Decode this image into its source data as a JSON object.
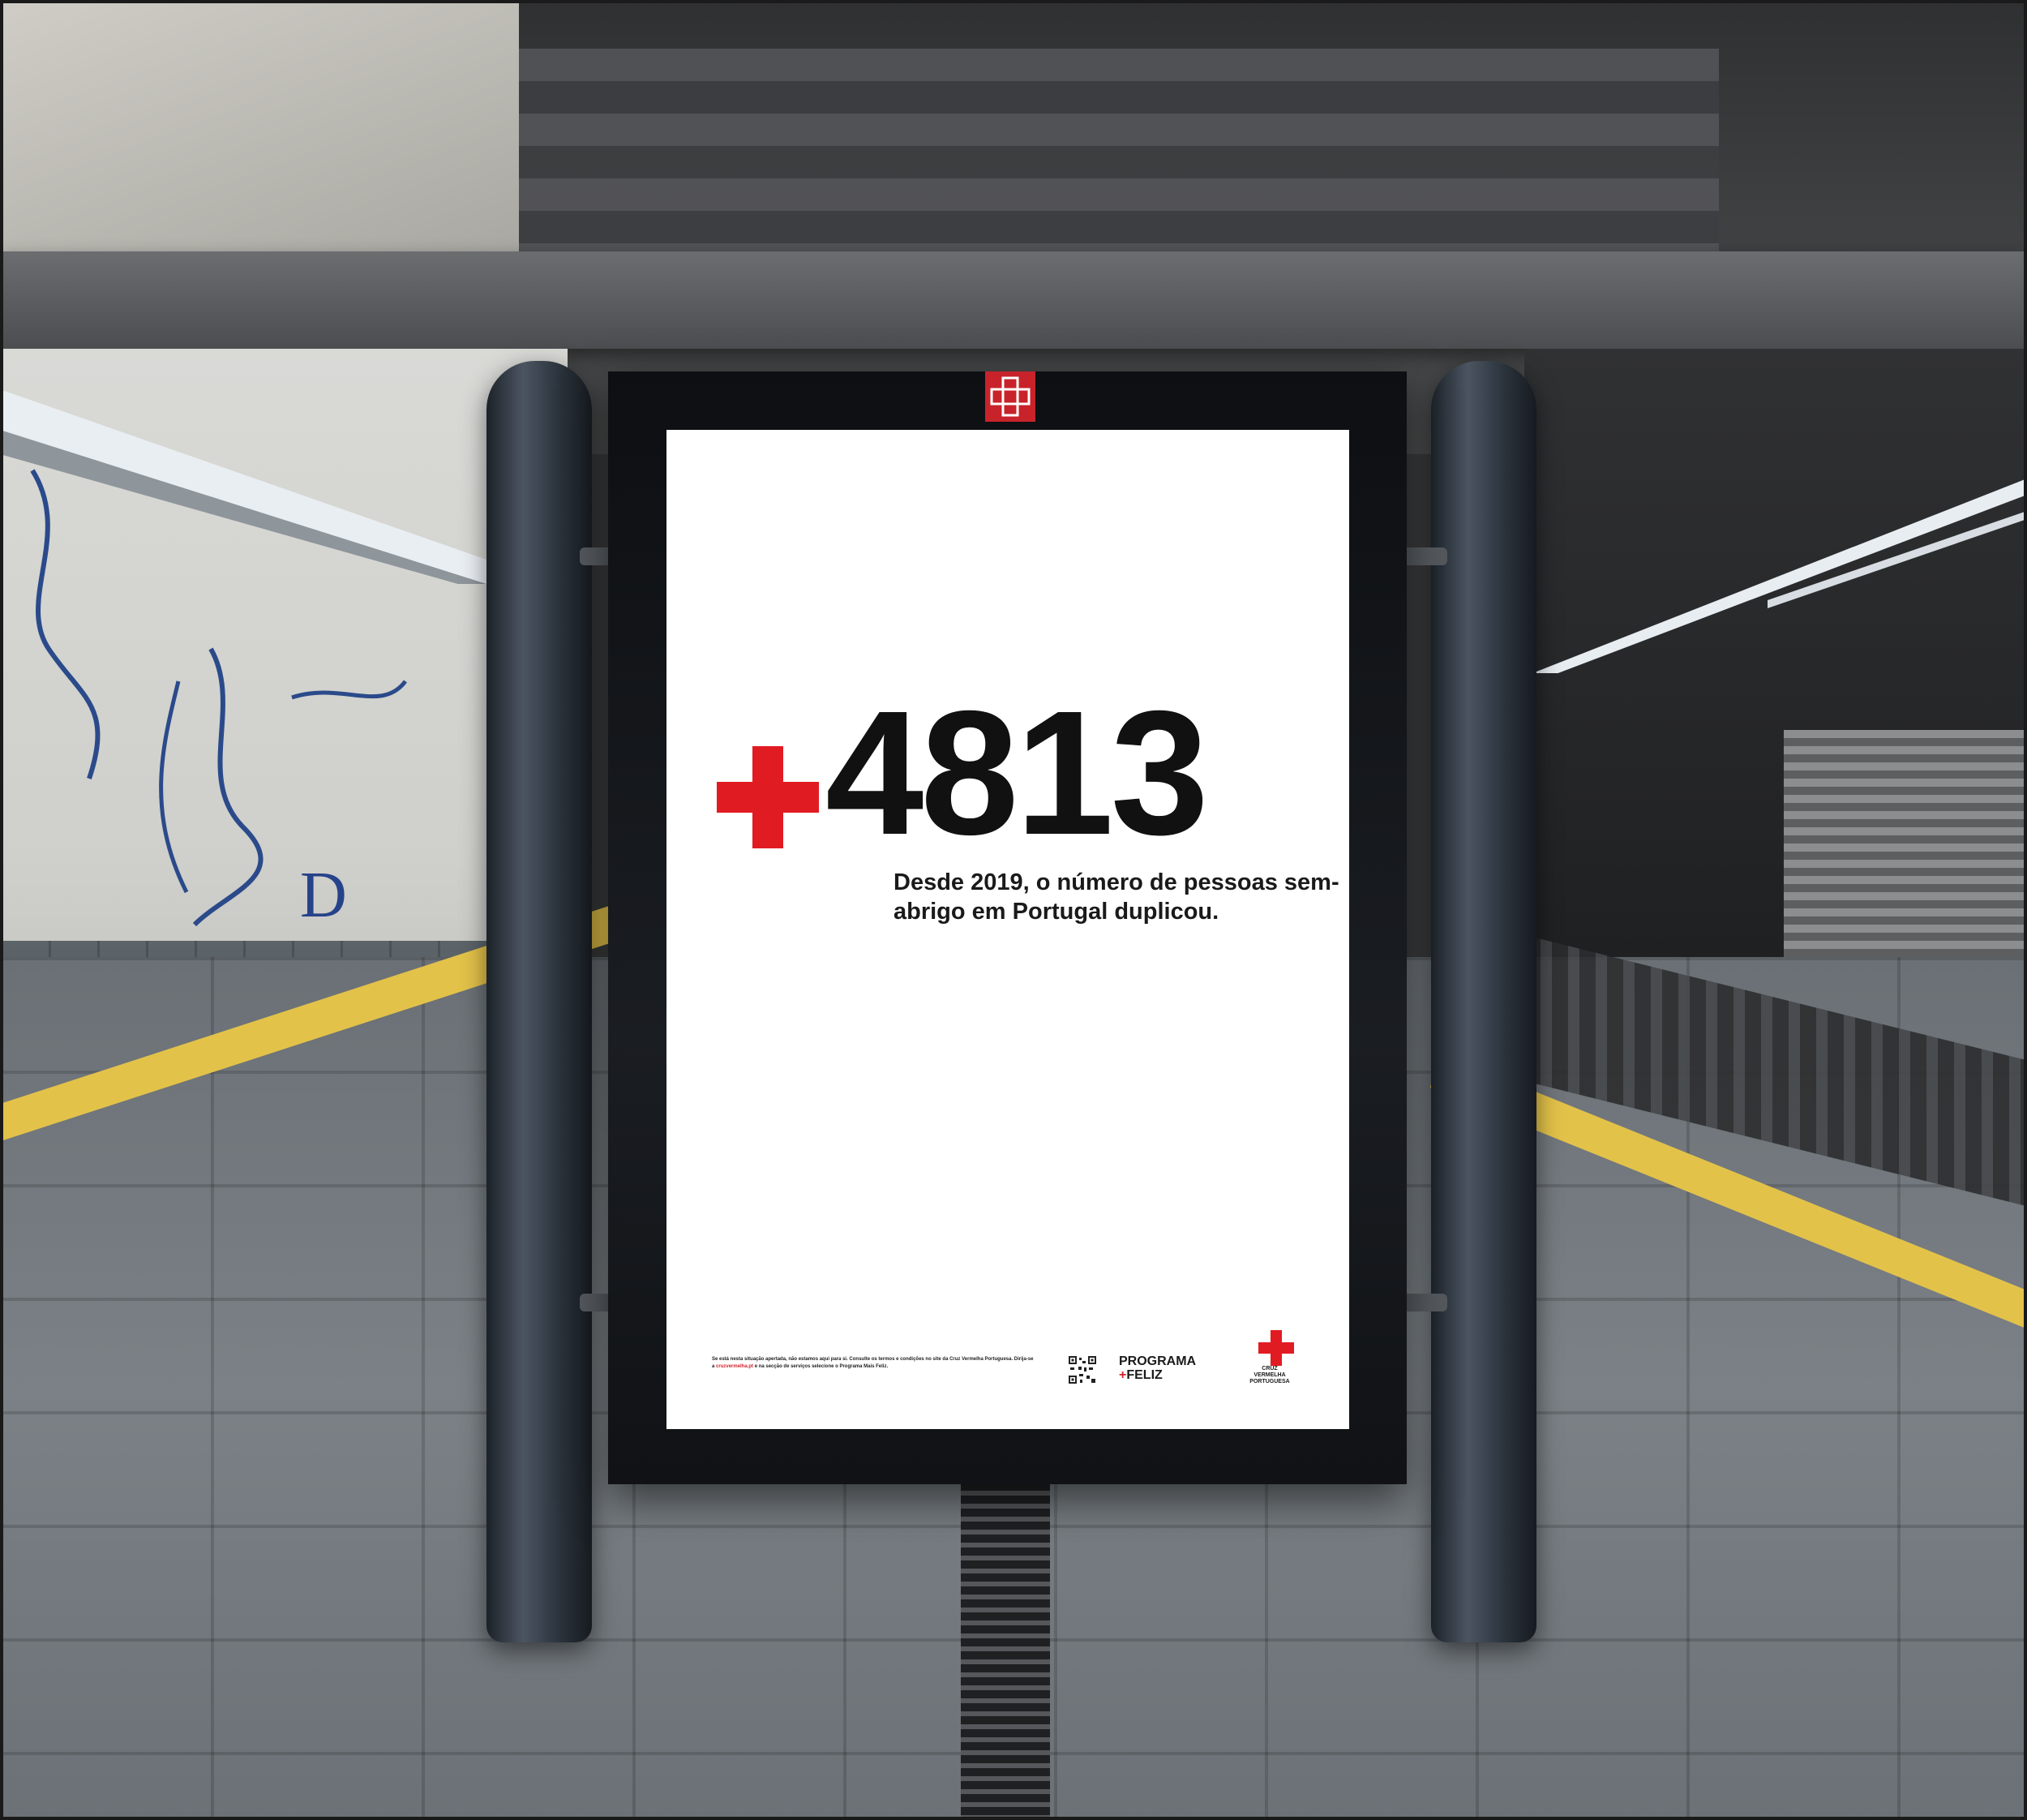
{
  "poster": {
    "big_number": "4813",
    "headline": "Desde 2019, o número de pessoas sem-abrigo em Portugal duplicou.",
    "footer_text_a": "Se está nesta situação apertada, não estamos aqui para si. Consulte os termos e condições no site da Cruz Vermelha Portuguesa. Dirija-se a ",
    "footer_link": "cruzvermelha.pt",
    "footer_text_b": " e na secção de serviços selecione o Programa Mais Feliz.",
    "programa_line1": "PROGRAMA",
    "programa_line2": "FELIZ",
    "programa_plus": "+",
    "organization_name": "CRUZ\nVERMELHA\nPORTUGUESA"
  },
  "scene": {
    "mural_letter": "D"
  },
  "colors": {
    "brand_red": "#d0202a",
    "poster_white": "#ffffff",
    "platform_yellow": "#e3c24a",
    "frame_dark": "#0d0f12"
  },
  "icons": {
    "board_logo": "red-cross-emblem-icon",
    "plus_sign": "red-plus-icon",
    "qr": "qr-code-icon",
    "cruz": "red-cross-icon"
  }
}
